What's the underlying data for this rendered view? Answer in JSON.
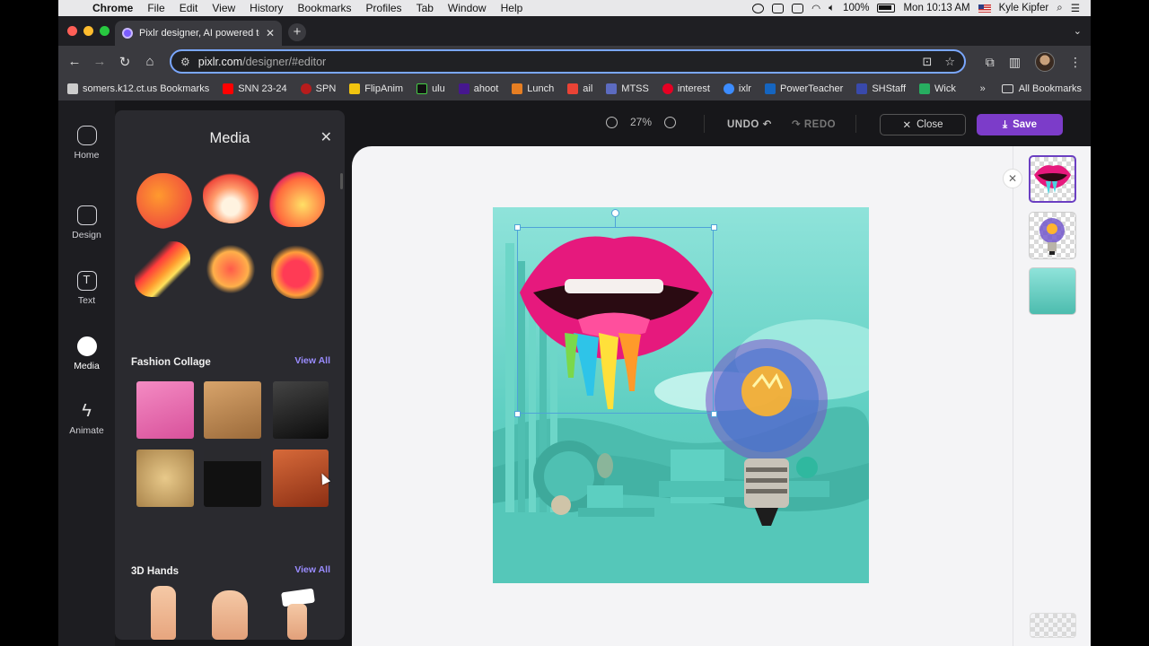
{
  "menubar": {
    "app": "Chrome",
    "items": [
      "File",
      "Edit",
      "View",
      "History",
      "Bookmarks",
      "Profiles",
      "Tab",
      "Window",
      "Help"
    ],
    "battery": "100%",
    "datetime": "Mon 10:13 AM",
    "user": "Kyle Kipfer"
  },
  "tab": {
    "title": "Pixlr designer, AI powered te"
  },
  "address": {
    "host": "pixlr.com",
    "path": "/designer/#editor"
  },
  "bookmarks": [
    {
      "label": "somers.k12.ct.us Bookmarks",
      "color": "#cccccc"
    },
    {
      "label": "SNN 23-24",
      "color": "#ff0000"
    },
    {
      "label": "SPN",
      "color": "#b71c1c"
    },
    {
      "label": "FlipAnim",
      "color": "#f1c40f"
    },
    {
      "label": "ulu",
      "color": "#111111"
    },
    {
      "label": "ahoot",
      "color": "#46178f"
    },
    {
      "label": "Lunch",
      "color": "#e67e22"
    },
    {
      "label": "ail",
      "color": "#ea4335"
    },
    {
      "label": "MTSS",
      "color": "#5c6bc0"
    },
    {
      "label": "interest",
      "color": "#e60023"
    },
    {
      "label": "ixlr",
      "color": "#3c8cff"
    },
    {
      "label": "PowerTeacher",
      "color": "#1565c0"
    },
    {
      "label": "SHStaff",
      "color": "#3949ab"
    },
    {
      "label": "Wick",
      "color": "#27ae60"
    }
  ],
  "bookmarks_all": "All Bookmarks",
  "rail": [
    {
      "label": "Home",
      "icon": "home-icon"
    },
    {
      "label": "Design",
      "icon": "design-icon"
    },
    {
      "label": "Text",
      "icon": "text-icon"
    },
    {
      "label": "Media",
      "icon": "media-icon"
    },
    {
      "label": "Animate",
      "icon": "bolt-icon"
    }
  ],
  "panel": {
    "title": "Media",
    "sections": [
      {
        "title": "Fashion Collage",
        "action": "View All"
      },
      {
        "title": "3D Hands",
        "action": "View All"
      }
    ]
  },
  "editor": {
    "zoom": "27%",
    "undo": "UNDO",
    "redo": "REDO",
    "close": "Close",
    "save": "Save"
  },
  "colors": {
    "accent": "#7c3cc9",
    "link": "#9a8cff"
  }
}
